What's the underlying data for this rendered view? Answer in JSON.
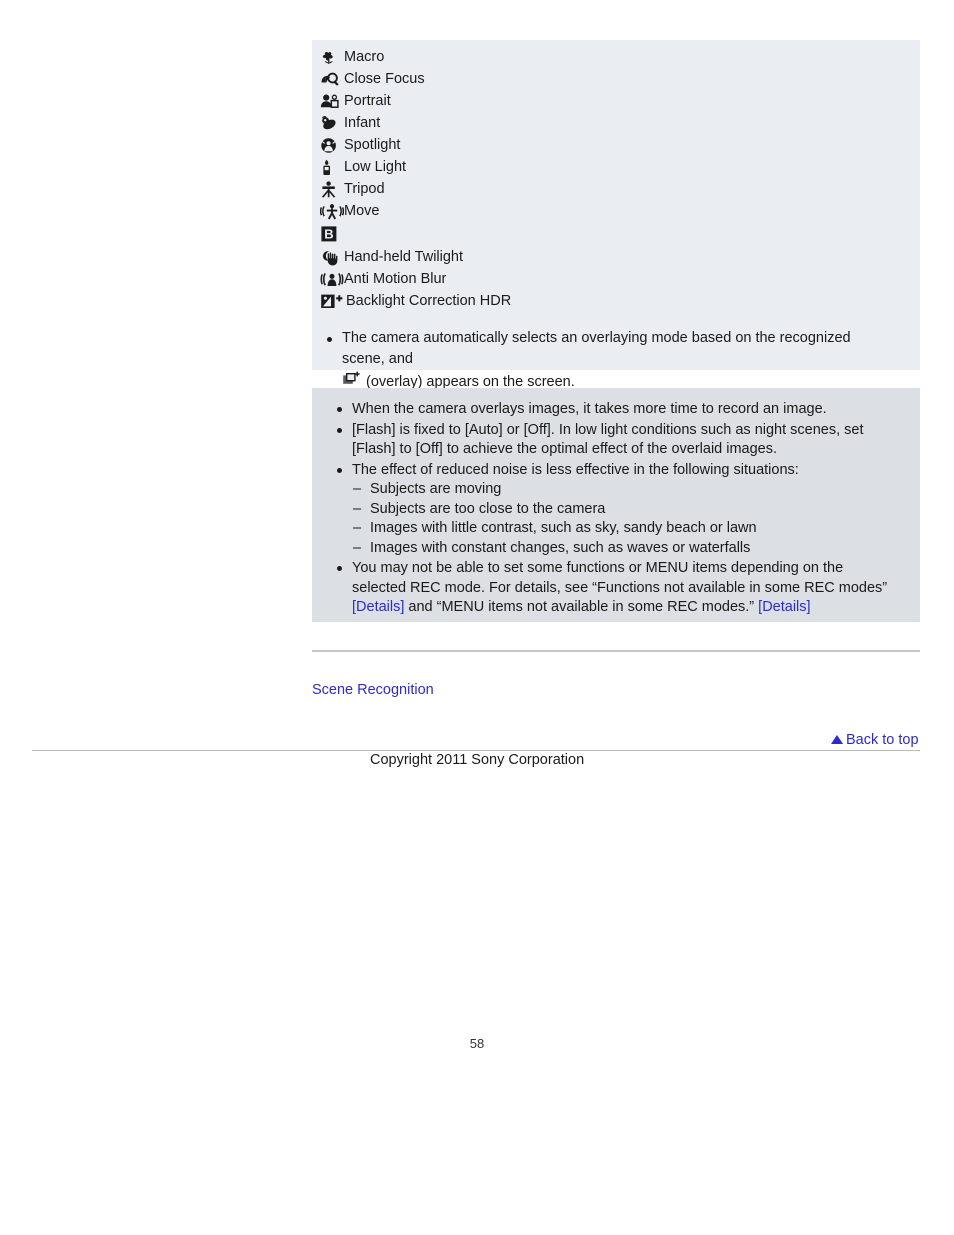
{
  "scene_list": {
    "items": [
      {
        "icon": "macro-icon",
        "label": "Macro"
      },
      {
        "icon": "close-focus-icon",
        "label": "Close Focus"
      },
      {
        "icon": "portrait-icon",
        "label": "Portrait"
      },
      {
        "icon": "infant-icon",
        "label": "Infant"
      },
      {
        "icon": "spotlight-icon",
        "label": "Spotlight"
      },
      {
        "icon": "low-light-icon",
        "label": "Low Light"
      },
      {
        "icon": "tripod-icon",
        "label": "Tripod"
      },
      {
        "icon": "move-icon",
        "label": "Move"
      },
      {
        "icon": "b-mode-icon",
        "label": ""
      },
      {
        "icon": "hand-held-twilight-icon",
        "label": "Hand-held Twilight"
      },
      {
        "icon": "anti-motion-blur-icon",
        "label": "Anti Motion Blur"
      },
      {
        "icon": "backlight-correction-hdr-icon",
        "label": "Backlight Correction HDR"
      }
    ],
    "overlay_note": {
      "line1": "The camera automatically selects an overlaying mode based on the recognized scene, and",
      "icon": "overlay-icon",
      "line2": "(overlay) appears on the screen."
    }
  },
  "notes": {
    "items": [
      {
        "text": "When the camera overlays images, it takes more time to record an image."
      },
      {
        "text": "[Flash] is fixed to [Auto] or [Off]. In low light conditions such as night scenes, set [Flash] to [Off] to achieve the optimal effect of the overlaid images."
      },
      {
        "text": "The effect of reduced noise is less effective in the following situations:",
        "sub": [
          "Subjects are moving",
          "Subjects are too close to the camera",
          "Images with little contrast, such as sky, sandy beach or lawn",
          "Images with constant changes, such as waves or waterfalls"
        ]
      },
      {
        "rich": true,
        "part1": "You may not be able to set some functions or MENU items depending on the selected REC mode. For details, see “Functions not available in some REC modes” ",
        "link1": "[Details]",
        "part2": " and “MENU items not available in some REC modes.” ",
        "link2": "[Details]"
      }
    ]
  },
  "footer": {
    "scene_recognition_link": "Scene Recognition",
    "back_to_top": "Back to top",
    "copyright": "Copyright 2011 Sony Corporation",
    "page_number": "58"
  },
  "colors": {
    "icon_box_bg": "#eaeef3",
    "notes_box_bg": "#dcdfe4",
    "link": "#2c2ccc",
    "text": "#1a1a1a",
    "rule": "#c6c6c6"
  }
}
